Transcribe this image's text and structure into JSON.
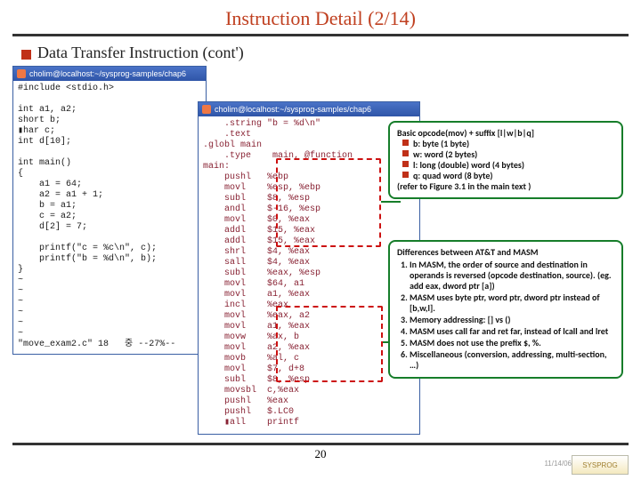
{
  "slide": {
    "title": "Instruction Detail (2/14)",
    "section": "Data Transfer Instruction (cont')",
    "page": "20"
  },
  "window_c": {
    "title": "cholim@localhost:~/sysprog-samples/chap6",
    "code": "#include <stdio.h>\n\nint a1, a2;\nshort b;\n▮har c;\nint d[10];\n\nint main()\n{\n    a1 = 64;\n    a2 = a1 + 1;\n    b = a1;\n    c = a2;\n    d[2] = 7;\n\n    printf(\"c = %c\\n\", c);\n    printf(\"b = %d\\n\", b);\n}\n~\n~\n~\n~\n~\n~\n\"move_exam2.c\" 18   중 --27%--"
  },
  "window_asm": {
    "title": "cholim@localhost:~/sysprog-samples/chap6",
    "code": "    .string \"b = %d\\n\"\n    .text\n.globl main\n    .type    main, @function\nmain:\n    pushl   %ebp\n    movl    %esp, %ebp\n    subl    $8, %esp\n    andl    $-16, %esp\n    movl    $0, %eax\n    addl    $15, %eax\n    addl    $15, %eax\n    shrl    $4, %eax\n    sall    $4, %eax\n    subl    %eax, %esp\n    movl    $64, a1\n    movl    a1, %eax\n    incl    %eax\n    movl    %eax, a2\n    movl    a1, %eax\n    movw    %ax, b\n    movl    a2, %eax\n    movb    %al, c\n    movl    $7, d+8\n    subl    $8, %esp\n    movsbl  c,%eax\n    pushl   %eax\n    pushl   $.LC0\n    ▮all    printf"
  },
  "callout1": {
    "heading": "Basic opcode(mov) + suffix [l|w|b|q]",
    "bullets": [
      "b:  byte (1 byte)",
      "w: word (2 bytes)",
      "l: long (double) word (4 bytes)",
      "q: quad word (8 byte)"
    ],
    "tail": "(refer to Figure 3.1 in the main text )"
  },
  "callout2": {
    "heading": "Differences between AT&T and MASM",
    "items": [
      "In MASM, the order of source and destination in operands is reversed (opcode  destination, source). (eg. add eax, dword ptr [a])",
      "MASM uses byte ptr, word ptr, dword ptr instead of [b,w,l].",
      "Memory addressing: [] vs ()",
      "MASM uses call far and ret far, instead of lcall and lret",
      "MASM does not use the prefix $, %.",
      "Miscellaneous (conversion, addressing, multi-section, …)"
    ]
  },
  "logo": "SYSPROG",
  "minilabel": "11/14/06"
}
